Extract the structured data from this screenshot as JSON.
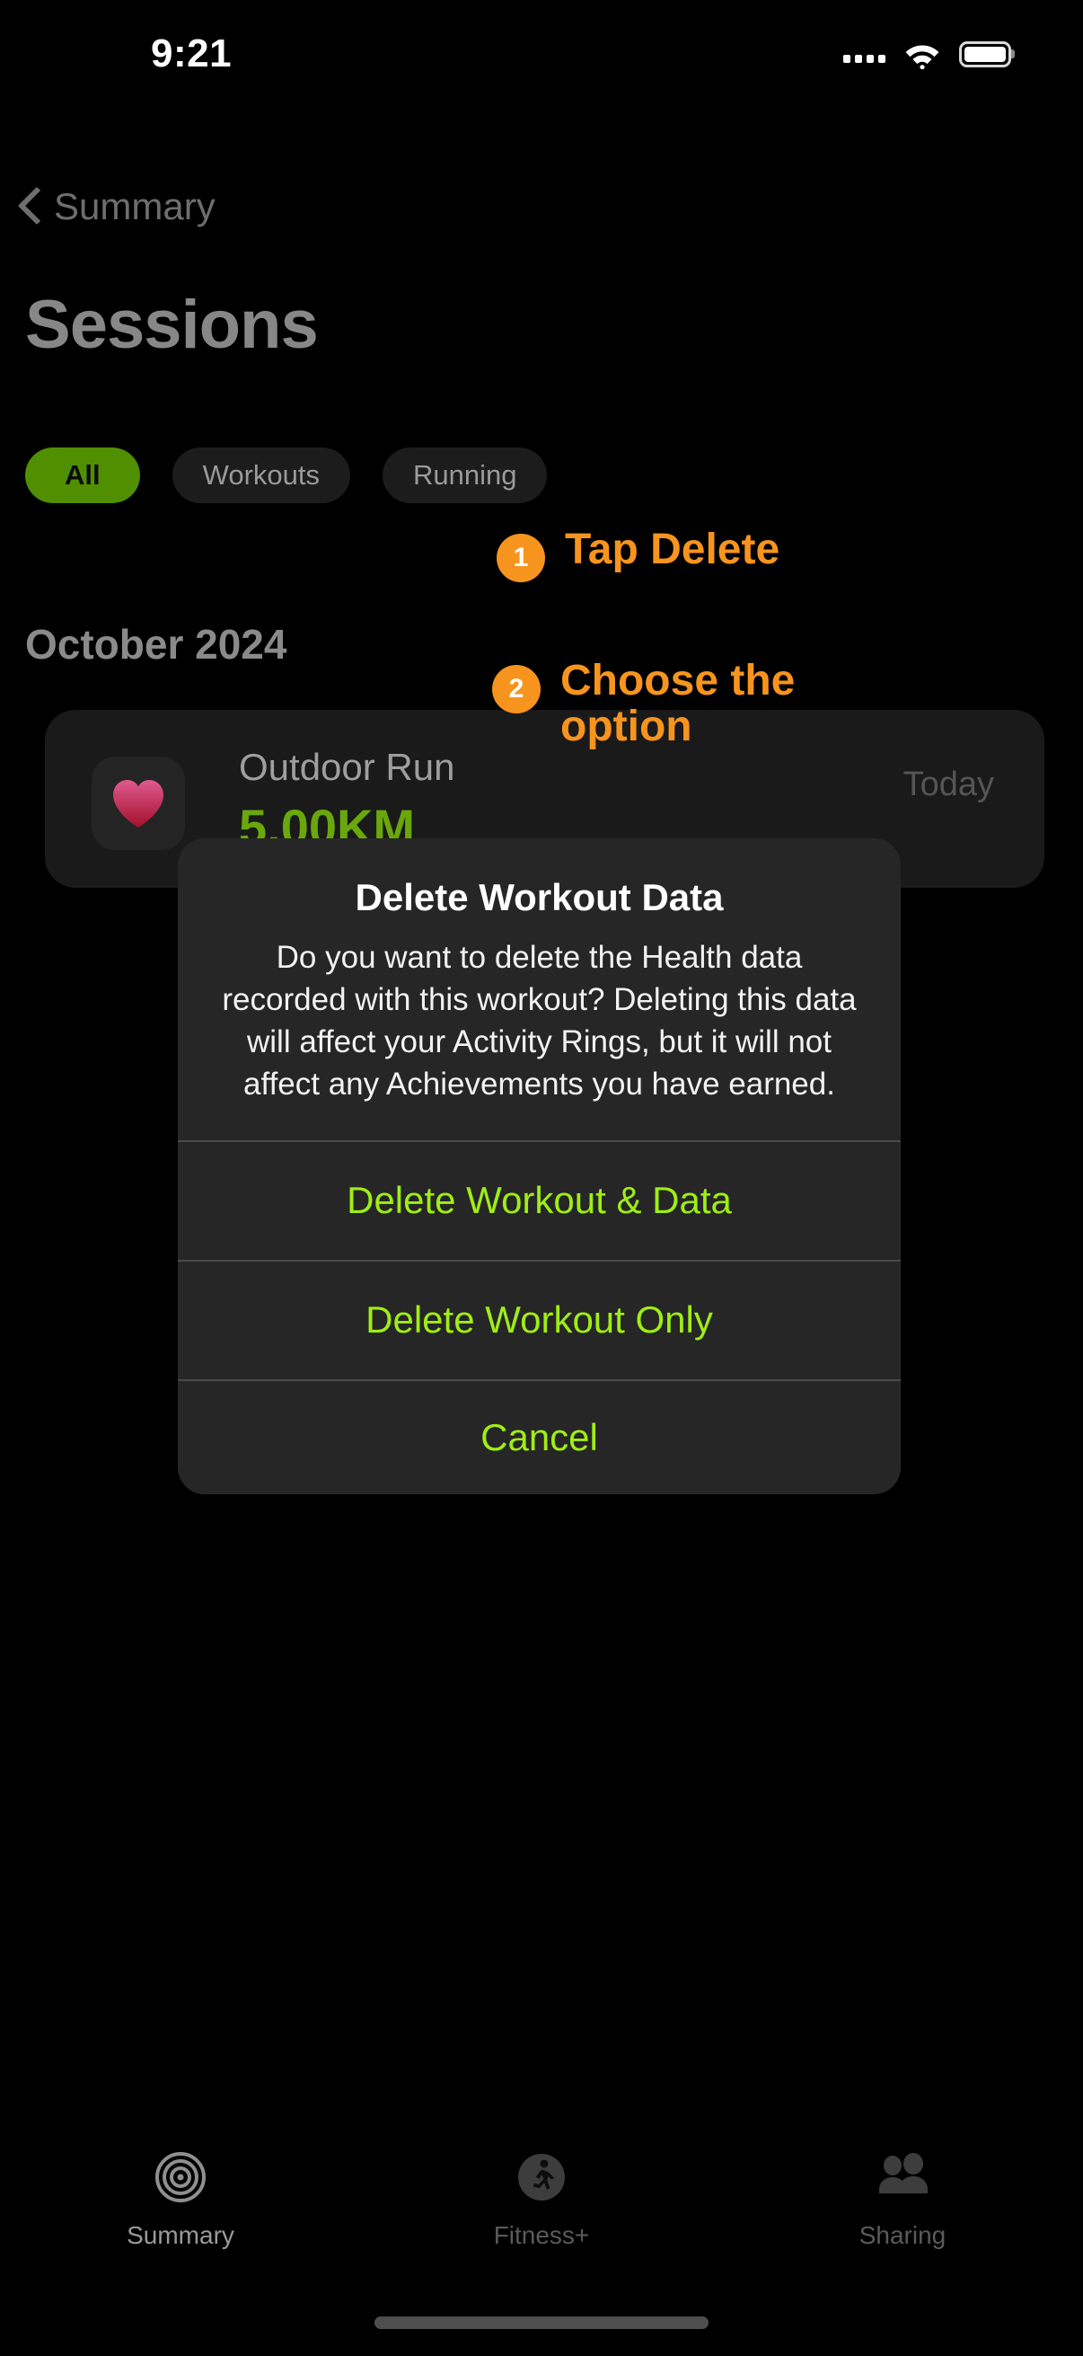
{
  "status_bar": {
    "time": "9:21",
    "icons": [
      "cellular-dots-icon",
      "wifi-icon",
      "battery-icon"
    ]
  },
  "nav": {
    "back_label": "Summary",
    "back_icon": "chevron-left-icon"
  },
  "header": {
    "title": "Sessions"
  },
  "filters": {
    "items": [
      {
        "label": "All",
        "selected": true
      },
      {
        "label": "Workouts",
        "selected": false
      },
      {
        "label": "Running",
        "selected": false
      }
    ]
  },
  "sections": {
    "month_label": "October 2024"
  },
  "workout": {
    "icon": "heart-icon",
    "name": "Outdoor Run",
    "distance": "5.00KM",
    "date": "Today"
  },
  "annotations": [
    {
      "number": "1",
      "text": "Tap Delete"
    },
    {
      "number": "2",
      "text": "Choose the option"
    }
  ],
  "alert": {
    "title": "Delete Workout Data",
    "message": "Do you want to delete the Health data recorded with this workout? Deleting this data will affect your Activity Rings, but it will not affect any Achievements you have earned.",
    "actions": [
      {
        "label": "Delete Workout & Data"
      },
      {
        "label": "Delete Workout Only"
      },
      {
        "label": "Cancel"
      }
    ]
  },
  "tab_bar": {
    "items": [
      {
        "label": "Summary",
        "icon": "activity-rings-icon",
        "active": true
      },
      {
        "label": "Fitness+",
        "icon": "running-person-icon",
        "active": false
      },
      {
        "label": "Sharing",
        "icon": "people-icon",
        "active": false
      }
    ]
  },
  "colors": {
    "accent_green": "#4f8f00",
    "action_green": "#9fee14",
    "annotation_orange": "#F7941D",
    "distance_green": "#69a70b",
    "background": "#000000",
    "card": "#1a1a1a",
    "alert": "#262626"
  }
}
